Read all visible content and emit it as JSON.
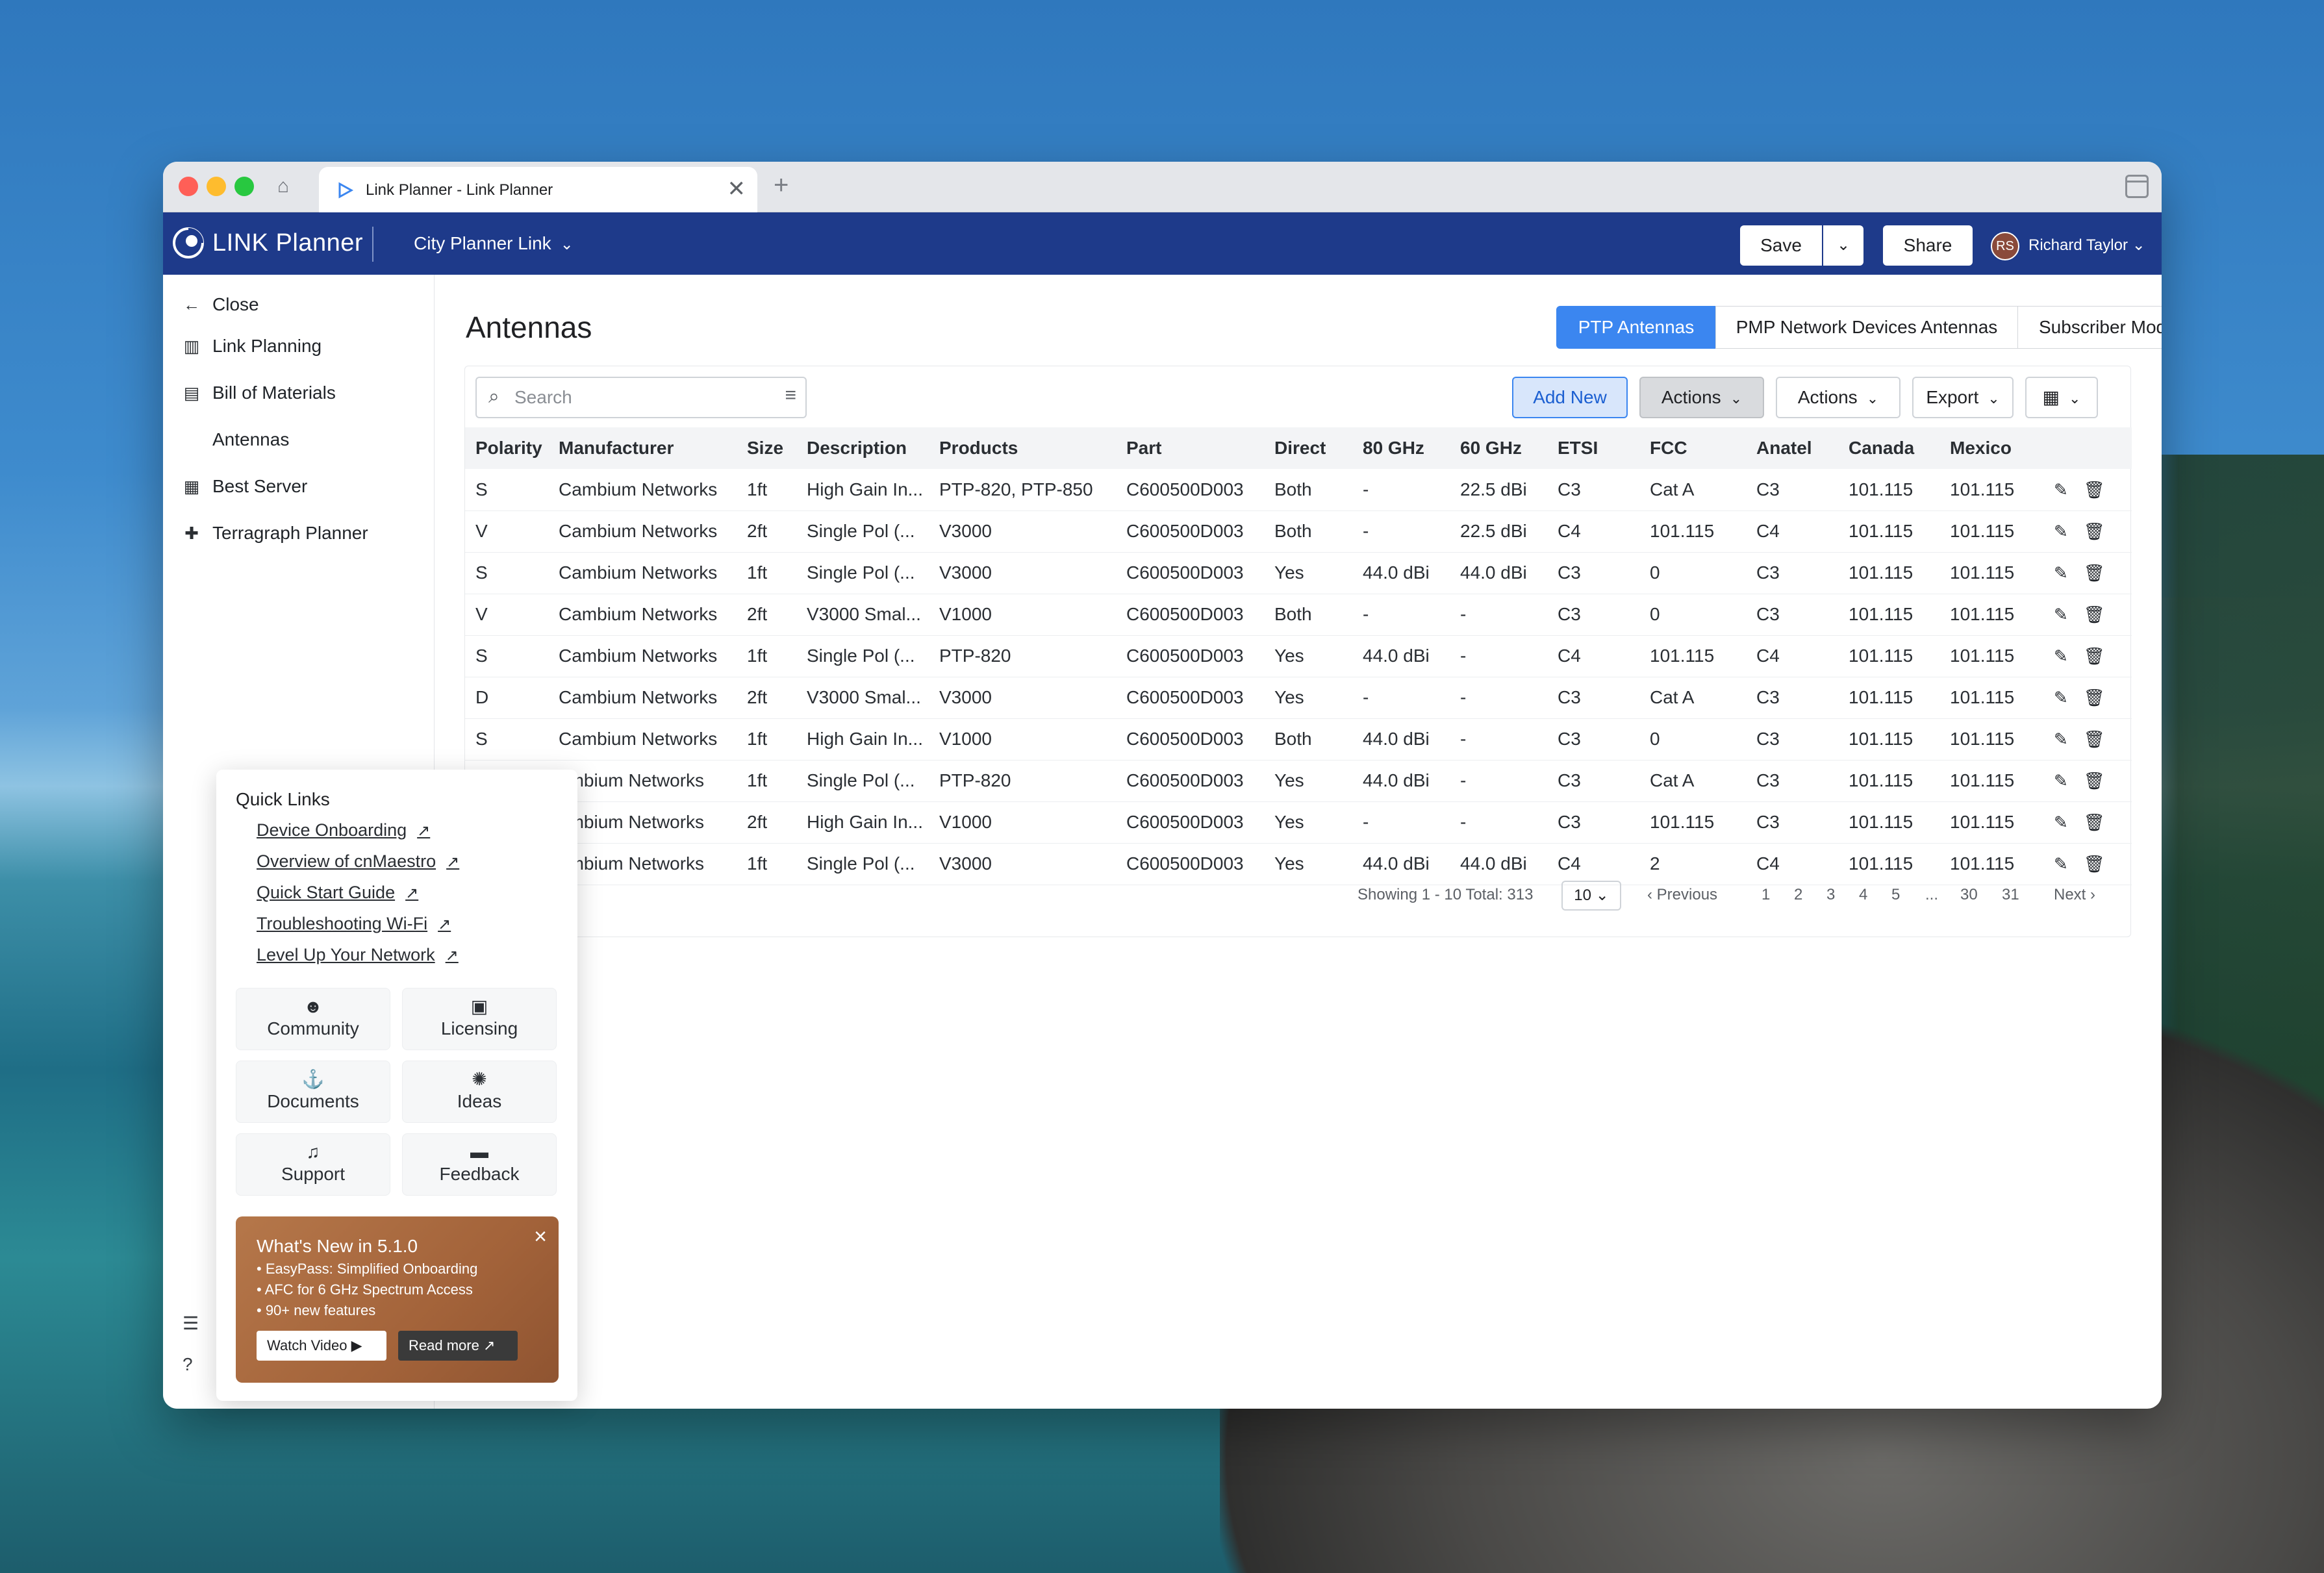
{
  "browser": {
    "tab_title": "Link Planner - Link Planner",
    "new_tab_glyph": "+",
    "close_glyph": "✕"
  },
  "header": {
    "app_name": "LINK Planner",
    "project": "City Planner Link",
    "save_label": "Save",
    "share_label": "Share",
    "user_initials": "RS",
    "user_name": "Richard Taylor"
  },
  "nav": {
    "close_label": "Close",
    "items": [
      {
        "label": "Link Planning",
        "icon": "map-icon"
      },
      {
        "label": "Bill of Materials",
        "icon": "document-list-icon"
      },
      {
        "label": "Antennas",
        "icon": "antenna-icon"
      },
      {
        "label": "Best Server",
        "icon": "server-icon"
      },
      {
        "label": "Terragraph Planner",
        "icon": "puzzle-icon"
      }
    ]
  },
  "main": {
    "title": "Antennas",
    "tabs": [
      "PTP Antennas",
      "PMP Network Devices Antennas",
      "Subscriber Module Antennas"
    ],
    "active_tab": "PTP Antennas",
    "search_placeholder": "Search",
    "buttons": {
      "add_new": "Add New",
      "actions_1": "Actions",
      "actions_2": "Actions",
      "export": "Export"
    },
    "columns": [
      "Polarity",
      "Manufacturer",
      "Size",
      "Description",
      "Products",
      "Part",
      "Direct",
      "80 GHz",
      "60 GHz",
      "ETSI",
      "FCC",
      "Anatel",
      "Canada",
      "Mexico"
    ],
    "rows": [
      [
        "S",
        "Cambium Networks",
        "1ft",
        "High Gain In...",
        "PTP-820, PTP-850",
        "C600500D003",
        "Both",
        "-",
        "22.5 dBi",
        "C3",
        "Cat A",
        "C3",
        "101.115",
        "101.115"
      ],
      [
        "V",
        "Cambium Networks",
        "2ft",
        "Single Pol (...",
        "V3000",
        "C600500D003",
        "Both",
        "-",
        "22.5 dBi",
        "C4",
        "101.115",
        "C4",
        "101.115",
        "101.115"
      ],
      [
        "S",
        "Cambium Networks",
        "1ft",
        "Single Pol (...",
        "V3000",
        "C600500D003",
        "Yes",
        "44.0 dBi",
        "44.0 dBi",
        "C3",
        "0",
        "C3",
        "101.115",
        "101.115"
      ],
      [
        "V",
        "Cambium Networks",
        "2ft",
        "V3000 Smal...",
        "V1000",
        "C600500D003",
        "Both",
        "-",
        "-",
        "C3",
        "0",
        "C3",
        "101.115",
        "101.115"
      ],
      [
        "S",
        "Cambium Networks",
        "1ft",
        "Single Pol (...",
        "PTP-820",
        "C600500D003",
        "Yes",
        "44.0 dBi",
        "-",
        "C4",
        "101.115",
        "C4",
        "101.115",
        "101.115"
      ],
      [
        "D",
        "Cambium Networks",
        "2ft",
        "V3000 Smal...",
        "V3000",
        "C600500D003",
        "Yes",
        "-",
        "-",
        "C3",
        "Cat A",
        "C3",
        "101.115",
        "101.115"
      ],
      [
        "S",
        "Cambium Networks",
        "1ft",
        "High Gain In...",
        "V1000",
        "C600500D003",
        "Both",
        "44.0 dBi",
        "-",
        "C3",
        "0",
        "C3",
        "101.115",
        "101.115"
      ],
      [
        "",
        "ambium Networks",
        "1ft",
        "Single Pol (...",
        "PTP-820",
        "C600500D003",
        "Yes",
        "44.0 dBi",
        "-",
        "C3",
        "Cat A",
        "C3",
        "101.115",
        "101.115"
      ],
      [
        "",
        "ambium Networks",
        "2ft",
        "High Gain In...",
        "V1000",
        "C600500D003",
        "Yes",
        "-",
        "-",
        "C3",
        "101.115",
        "C3",
        "101.115",
        "101.115"
      ],
      [
        "",
        "ambium Networks",
        "1ft",
        "Single Pol (...",
        "V3000",
        "C600500D003",
        "Yes",
        "44.0 dBi",
        "44.0 dBi",
        "C4",
        "2",
        "C4",
        "101.115",
        "101.115"
      ]
    ],
    "pagination": {
      "showing": "Showing 1 - 10 Total: 313",
      "page_size": "10",
      "previous": "Previous",
      "pages": [
        "1",
        "2",
        "3",
        "4",
        "5",
        "...",
        "30",
        "31"
      ],
      "next": "Next"
    }
  },
  "quick_links": {
    "title": "Quick Links",
    "links": [
      "Device Onboarding",
      "Overview of cnMaestro",
      "Quick Start Guide",
      "Troubleshooting Wi-Fi",
      "Level Up Your Network"
    ],
    "tiles": [
      {
        "label": "Community",
        "icon": "community-icon"
      },
      {
        "label": "Licensing",
        "icon": "license-icon"
      },
      {
        "label": "Documents",
        "icon": "documents-icon"
      },
      {
        "label": "Ideas",
        "icon": "ideas-icon"
      },
      {
        "label": "Support",
        "icon": "headset-icon"
      },
      {
        "label": "Feedback",
        "icon": "chat-icon"
      }
    ],
    "promo": {
      "title": "What's New in 5.1.0",
      "lines": [
        "• EasyPass: Simplified Onboarding",
        "• AFC for 6 GHz Spectrum Access",
        "• 90+ new features"
      ],
      "watch_video": "Watch Video",
      "read_more": "Read more"
    }
  },
  "colors": {
    "appbar": "#1e3a8a",
    "accent": "#3b86f0",
    "promo": "#a3633a"
  }
}
